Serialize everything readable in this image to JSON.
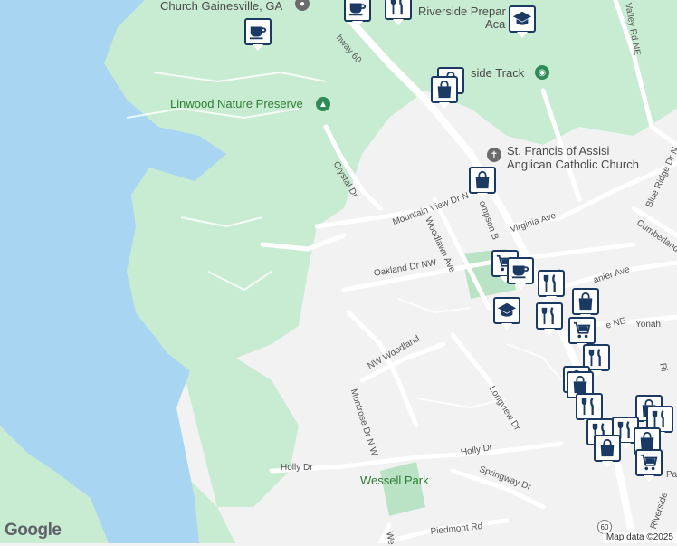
{
  "colors": {
    "water": "#a8d5f2",
    "park": "#c8ecd2",
    "land": "#f2f2f2",
    "road": "#ffffff",
    "pin_border": "#1b3a63",
    "poi_green": "#2e8b57",
    "poi_gray": "#6b6b6b"
  },
  "places": {
    "church_gainesville": "Church Gainesville, GA",
    "riverside_prep": "Riverside Prepar",
    "riverside_prep_2": "Aca",
    "riverside_track": "side Track",
    "linwood": "Linwood Nature Preserve",
    "st_francis_1": "St. Francis of Assisi",
    "st_francis_2": "Anglican Catholic Church",
    "wessell_park": "Wessell Park"
  },
  "roads": {
    "hwy60": "hway 60",
    "crystal": "Crystal Dr",
    "mountain_view": "Mountain View Dr N",
    "woodlawn": "Woodlawn Ave",
    "thompson": "ompson B",
    "virginia": "Virginia Ave",
    "oakland": "Oakland Dr NW",
    "nw_woodland": "NW Woodland",
    "montrose": "Montrose Dr N W",
    "longview": "Longview Dr",
    "holly_left": "Holly Dr",
    "holly_right": "Holly Dr",
    "springway": "Springway Dr",
    "piedmont": "Piedmont Rd",
    "we": "We",
    "valley": "Valley Rd NE",
    "blue_ridge": "Blue Ridge Dr N",
    "cumberland": "Cumberland",
    "lanier": "anier Ave",
    "yonah": "Yonah",
    "ne": "e NE",
    "w": "W",
    "riverside": "Riverside",
    "pa": "Pa",
    "ri": "Ri",
    "route60": "60"
  },
  "footer": {
    "google": "Google",
    "attribution": "Map data ©2025"
  },
  "markers": [
    {
      "type": "coffee",
      "name": "coffee-icon"
    },
    {
      "type": "restaurant",
      "name": "restaurant-icon"
    },
    {
      "type": "school",
      "name": "school-icon"
    },
    {
      "type": "coffee",
      "name": "coffee-icon"
    },
    {
      "type": "shopping",
      "name": "shopping-bag-icon"
    },
    {
      "type": "shopping",
      "name": "shopping-bag-icon"
    },
    {
      "type": "shopping",
      "name": "shopping-bag-icon"
    },
    {
      "type": "grocery",
      "name": "shopping-cart-icon"
    },
    {
      "type": "coffee",
      "name": "coffee-icon"
    },
    {
      "type": "restaurant",
      "name": "restaurant-icon"
    },
    {
      "type": "school",
      "name": "school-icon"
    },
    {
      "type": "restaurant",
      "name": "restaurant-icon"
    },
    {
      "type": "shopping",
      "name": "shopping-bag-icon"
    },
    {
      "type": "grocery",
      "name": "shopping-cart-icon"
    },
    {
      "type": "restaurant",
      "name": "restaurant-icon"
    },
    {
      "type": "shopping",
      "name": "shopping-bag-icon"
    },
    {
      "type": "shopping",
      "name": "shopping-bag-icon"
    },
    {
      "type": "restaurant",
      "name": "restaurant-icon"
    },
    {
      "type": "shopping",
      "name": "shopping-bag-icon"
    },
    {
      "type": "restaurant",
      "name": "restaurant-icon"
    },
    {
      "type": "restaurant",
      "name": "restaurant-icon"
    },
    {
      "type": "restaurant",
      "name": "restaurant-icon"
    },
    {
      "type": "shopping",
      "name": "shopping-bag-icon"
    },
    {
      "type": "shopping",
      "name": "shopping-bag-icon"
    },
    {
      "type": "grocery",
      "name": "shopping-cart-icon"
    }
  ]
}
